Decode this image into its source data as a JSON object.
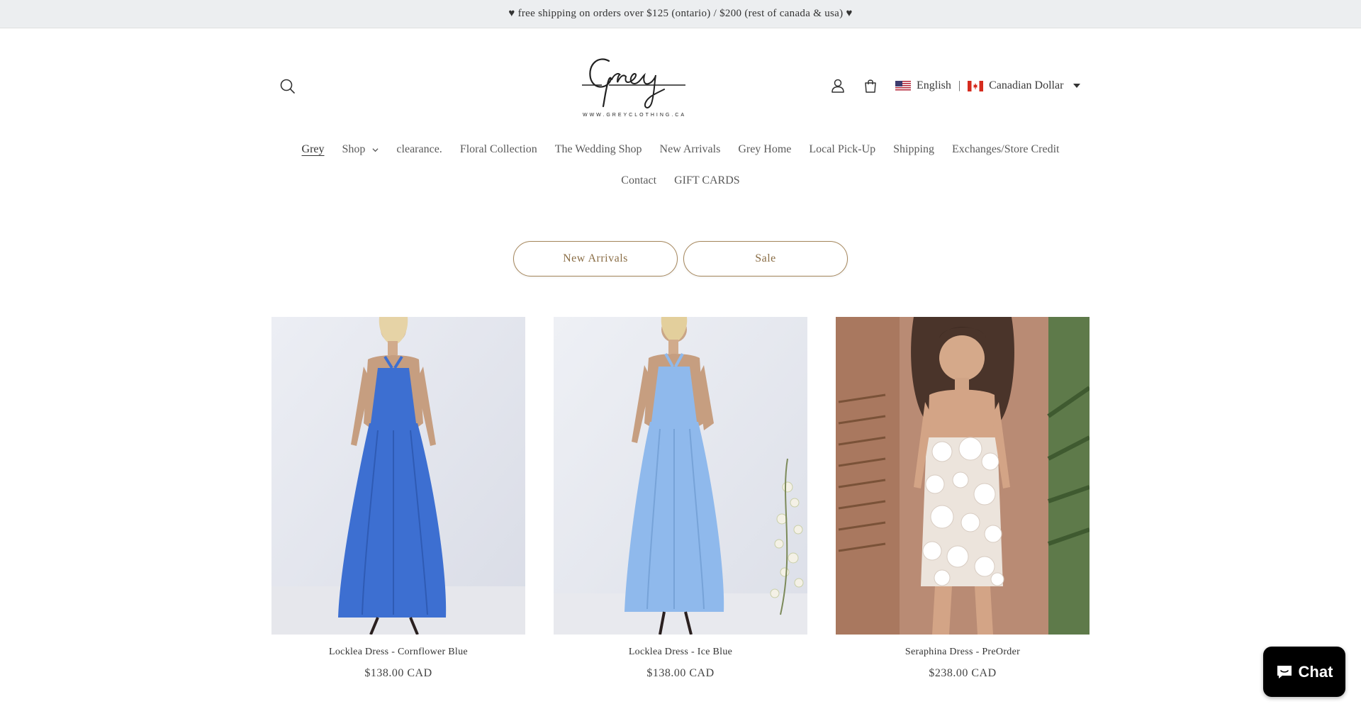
{
  "announcement": {
    "text": "♥ free shipping on orders over $125 (ontario) / $200 (rest of canada & usa) ♥"
  },
  "header": {
    "logo_text": "Grey",
    "logo_url_text": "WWW.GREYCLOTHING.CA",
    "locale": {
      "language": "English",
      "separator": "|",
      "currency": "Canadian Dollar"
    }
  },
  "nav": {
    "row1": [
      {
        "label": "Grey",
        "active": true
      },
      {
        "label": "Shop",
        "dropdown": true
      },
      {
        "label": "clearance."
      },
      {
        "label": "Floral Collection"
      },
      {
        "label": "The Wedding Shop"
      },
      {
        "label": "New Arrivals"
      },
      {
        "label": "Grey Home"
      },
      {
        "label": "Local Pick-Up"
      },
      {
        "label": "Shipping"
      },
      {
        "label": "Exchanges/Store Credit"
      }
    ],
    "row2": [
      {
        "label": "Contact"
      },
      {
        "label": "GIFT CARDS"
      }
    ]
  },
  "filters": {
    "new_arrivals": "New Arrivals",
    "sale": "Sale"
  },
  "products": [
    {
      "title": "Locklea Dress - Cornflower Blue",
      "price": "$138.00 CAD",
      "color": "#3d6fd1"
    },
    {
      "title": "Locklea Dress - Ice Blue",
      "price": "$138.00 CAD",
      "color": "#8fb9ec"
    },
    {
      "title": "Seraphina Dress - PreOrder",
      "price": "$238.00 CAD",
      "color": "#ece4dc"
    }
  ],
  "chat": {
    "label": "Chat"
  },
  "colors": {
    "accent": "#a5865b",
    "announcement_bg": "#eceef0"
  }
}
